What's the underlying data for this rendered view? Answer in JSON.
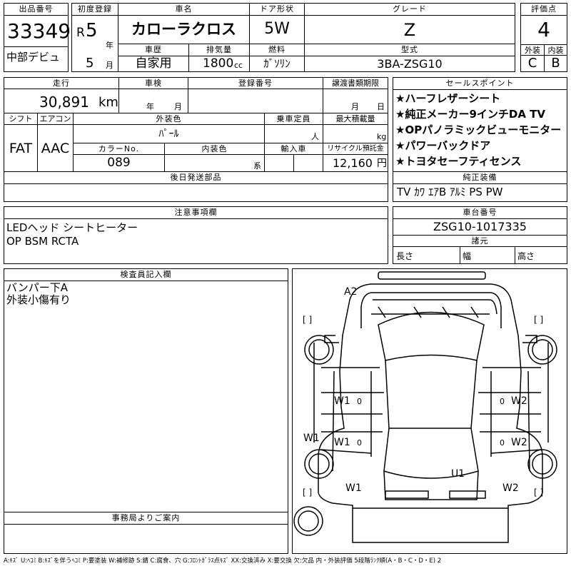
{
  "header": {
    "lot_label": "出品番号",
    "lot_number": "33349",
    "venue": "中部デビュ",
    "first_reg_label": "初度登録",
    "era": "R",
    "year": "5",
    "year_unit": "年",
    "month": "5",
    "month_unit": "月",
    "car_name_label": "車名",
    "car_name": "カローラクロス",
    "door_label": "ドア形状",
    "door": "5W",
    "grade_label": "グレード",
    "grade": "Z",
    "score_label": "評価点",
    "score": "4",
    "ext_label": "外装",
    "int_label": "内装",
    "ext_grade": "C",
    "int_grade": "B",
    "history_label": "車歴",
    "history": "自家用",
    "displacement_label": "排気量",
    "displacement": "1800",
    "displacement_unit": "cc",
    "fuel_label": "燃料",
    "fuel": "ｶﾞｿﾘﾝ",
    "model_label": "型式",
    "model": "3BA-ZSG10"
  },
  "details": {
    "mileage_label": "走行",
    "mileage": "30,891",
    "mileage_unit": "km",
    "inspection_label": "車検",
    "insp_year_unit": "年",
    "insp_month_unit": "月",
    "reg_label": "登録番号",
    "transfer_label": "譲渡書類期限",
    "transfer_month_unit": "月",
    "transfer_day_unit": "日",
    "shift_label": "シフト",
    "shift": "FAT",
    "aircon_label": "エアコン",
    "aircon": "AAC",
    "ext_color_label": "外装色",
    "ext_color": "ﾊﾟｰﾙ",
    "capacity_label": "乗車定員",
    "capacity_unit": "人",
    "load_label": "最大積載量",
    "load_unit": "kg",
    "color_no_label": "カラーNo.",
    "color_no": "089",
    "int_color_label": "内装色",
    "int_color_unit": "系",
    "import_label": "輸入車",
    "recycle_label": "リサイクル預託金",
    "recycle": "12,160",
    "recycle_unit": "円",
    "later_parts_label": "後日発送部品"
  },
  "sales_points": {
    "title": "セールスポイント",
    "items": [
      "★ハーフレザーシート",
      "★純正メーカー9インチDA TV",
      "★OPパノラミックビューモニター",
      "★パワーバックドア",
      "★トヨタセーフティセンス"
    ]
  },
  "equipment": {
    "title": "純正装備",
    "value": "TV ｶﾜ ｴｱB ｱﾙﾐ PS PW"
  },
  "notes": {
    "title": "注意事項欄",
    "lines": [
      "LEDヘッド シートヒーター",
      "OP BSM RCTA"
    ]
  },
  "chassis": {
    "title": "車台番号",
    "value": "ZSG10-1017335"
  },
  "dimensions": {
    "title": "諸元",
    "length": "長さ",
    "width": "幅",
    "height": "高さ"
  },
  "inspector": {
    "title": "検査員記入欄",
    "lines": [
      "バンパー下A",
      "外装小傷有り"
    ]
  },
  "office": {
    "title": "事務局よりご案内"
  },
  "diagram": {
    "a2": "A2",
    "w1a": "W1",
    "w1b": "W1",
    "w1c": "W1",
    "w1d": "W1",
    "w2a": "W2",
    "w2b": "W2",
    "w2c": "W2",
    "u1": "U1",
    "zero1": "0",
    "zero2": "0",
    "zero3": "0",
    "zero4": "0",
    "bracket": "[ ]"
  },
  "legend": "A:ｷｽﾞ U:ﾍｺﾐ B:ｷｽﾞを伴うﾍｺﾐ P:要塗装 W:補修跡 S:錆 C:腐食、穴 G:ﾌﾛﾝﾄｶﾞﾗｽ点ｷｽﾞ XX:交換済み X:要交換 欠:欠品 内・外装評価 5段階ﾗﾝｸ順(A・B・C・D・E) 2"
}
